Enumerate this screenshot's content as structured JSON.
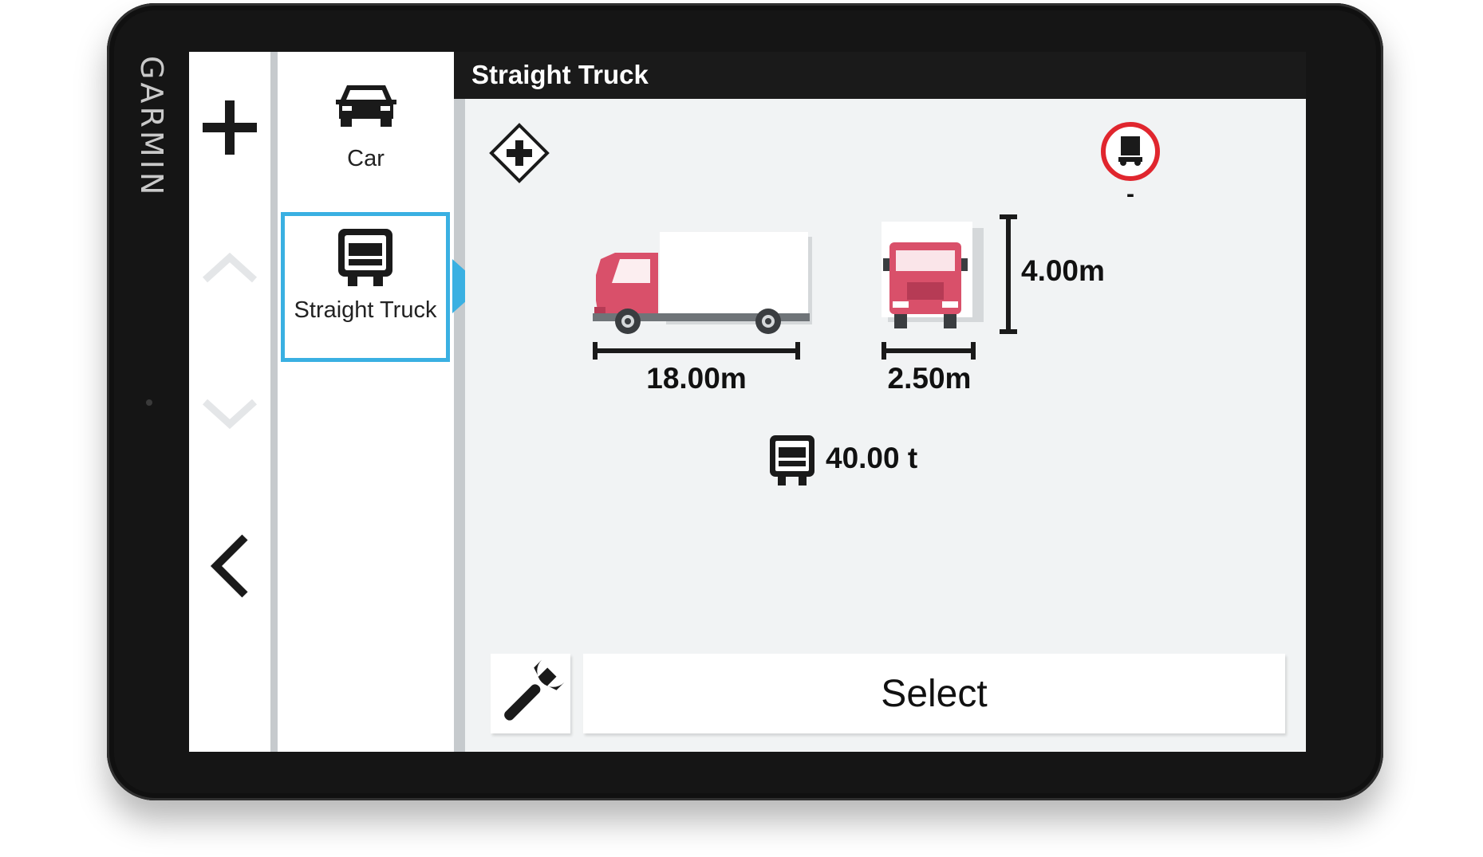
{
  "device": {
    "brand": "GARMIN"
  },
  "header": {
    "title": "Straight Truck"
  },
  "vehicle_list": {
    "items": [
      {
        "label": "Car",
        "icon": "car-icon"
      },
      {
        "label": "Straight Truck",
        "icon": "truck-icon",
        "selected": true
      }
    ]
  },
  "profile": {
    "length": "18.00m",
    "width": "2.50m",
    "height": "4.00m",
    "weight": "40.00 t",
    "restriction_value": "-"
  },
  "actions": {
    "select_label": "Select"
  },
  "colors": {
    "accent": "#3ab0e2",
    "header": "#1a1a1a",
    "truck_red": "#d9506a",
    "restriction_red": "#e0262e"
  }
}
